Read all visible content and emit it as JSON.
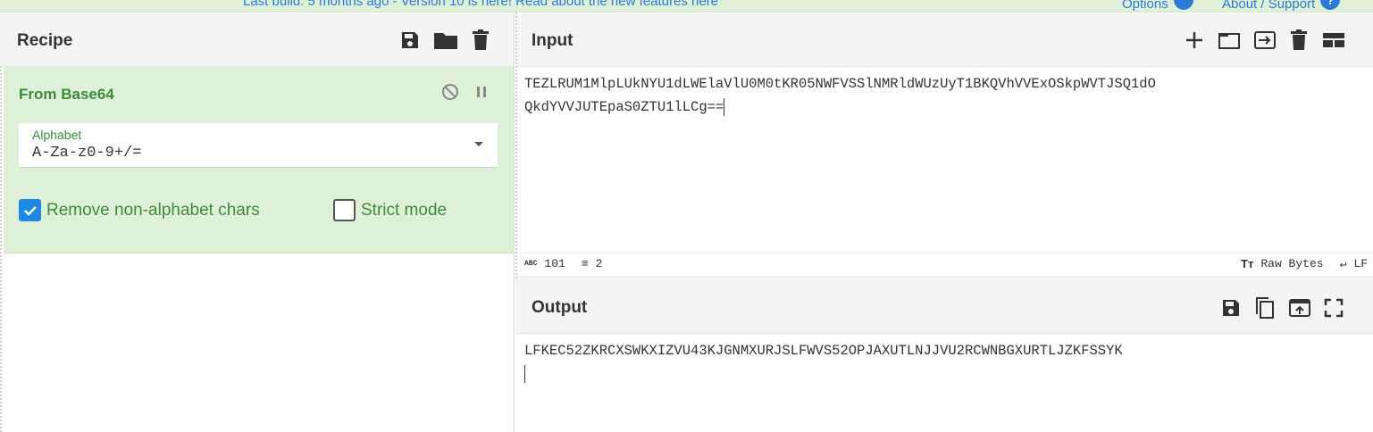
{
  "banner": {
    "build_text": "Last build: 5 months ago - Version 10 is here! Read about the new features here",
    "options_label": "Options",
    "support_label": "About / Support",
    "accent_color": "#2a7ad6"
  },
  "recipe": {
    "title": "Recipe",
    "toolbar_icons": [
      "save-icon",
      "folder-icon",
      "trash-icon"
    ],
    "operation": {
      "title": "From Base64",
      "controls": [
        "disable-icon",
        "pause-icon"
      ],
      "alphabet_label": "Alphabet",
      "alphabet_value": "A-Za-z0-9+/=",
      "remove_non_alphabet": {
        "label": "Remove non-alphabet chars",
        "checked": true
      },
      "strict_mode": {
        "label": "Strict mode",
        "checked": false
      }
    }
  },
  "input": {
    "title": "Input",
    "toolbar_icons": [
      "plus-icon",
      "window-icon",
      "import-icon",
      "trash-icon",
      "layout-icon"
    ],
    "line1": "TEZLRUM1MlpLUkNYU1dLWElaVlU0M0tKR05NWFVSSlNMRldWUzUyT1BKQVhVVExOSkpWVTJSQ1dO",
    "line2": "QkdYVVJUTEpaS0ZTU1lLCg==",
    "status": {
      "chars": "101",
      "lines": "2",
      "encoding": "Raw Bytes",
      "eol": "LF"
    }
  },
  "output": {
    "title": "Output",
    "toolbar_icons": [
      "save-icon",
      "copy-icon",
      "replace-input-icon",
      "fullscreen-icon"
    ],
    "text": "LFKEC52ZKRCXSWKXIZVU43KJGNMXURJSLFWVS52OPJAXUTLNJJVU2RCWNBGXURTLJZKFSSYK"
  }
}
